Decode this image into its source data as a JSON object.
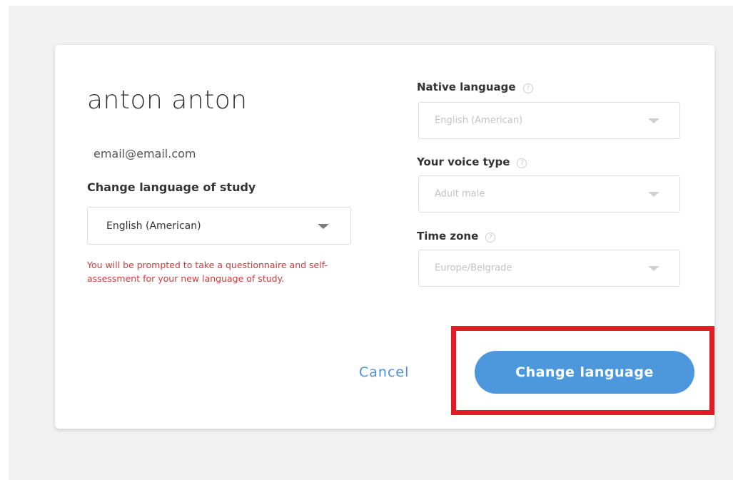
{
  "profile": {
    "name": "anton anton",
    "email": "email@email.com"
  },
  "study": {
    "label": "Change language of study",
    "selected": "English (American)",
    "warning": "You will be prompted to take a questionnaire and self-assessment for your new language of study."
  },
  "settings": {
    "native_language": {
      "label": "Native language",
      "value": "English (American)"
    },
    "voice_type": {
      "label": "Your voice type",
      "value": "Adult male"
    },
    "time_zone": {
      "label": "Time zone",
      "value": "Europe/Belgrade"
    }
  },
  "actions": {
    "cancel_label": "Cancel",
    "submit_label": "Change language"
  },
  "icons": {
    "info": "info-icon",
    "dropdown": "chevron-down-icon"
  },
  "colors": {
    "primary": "#4d98dd",
    "link": "#4a90d9",
    "warning": "#cf3a3a",
    "highlight": "#e01c24"
  }
}
